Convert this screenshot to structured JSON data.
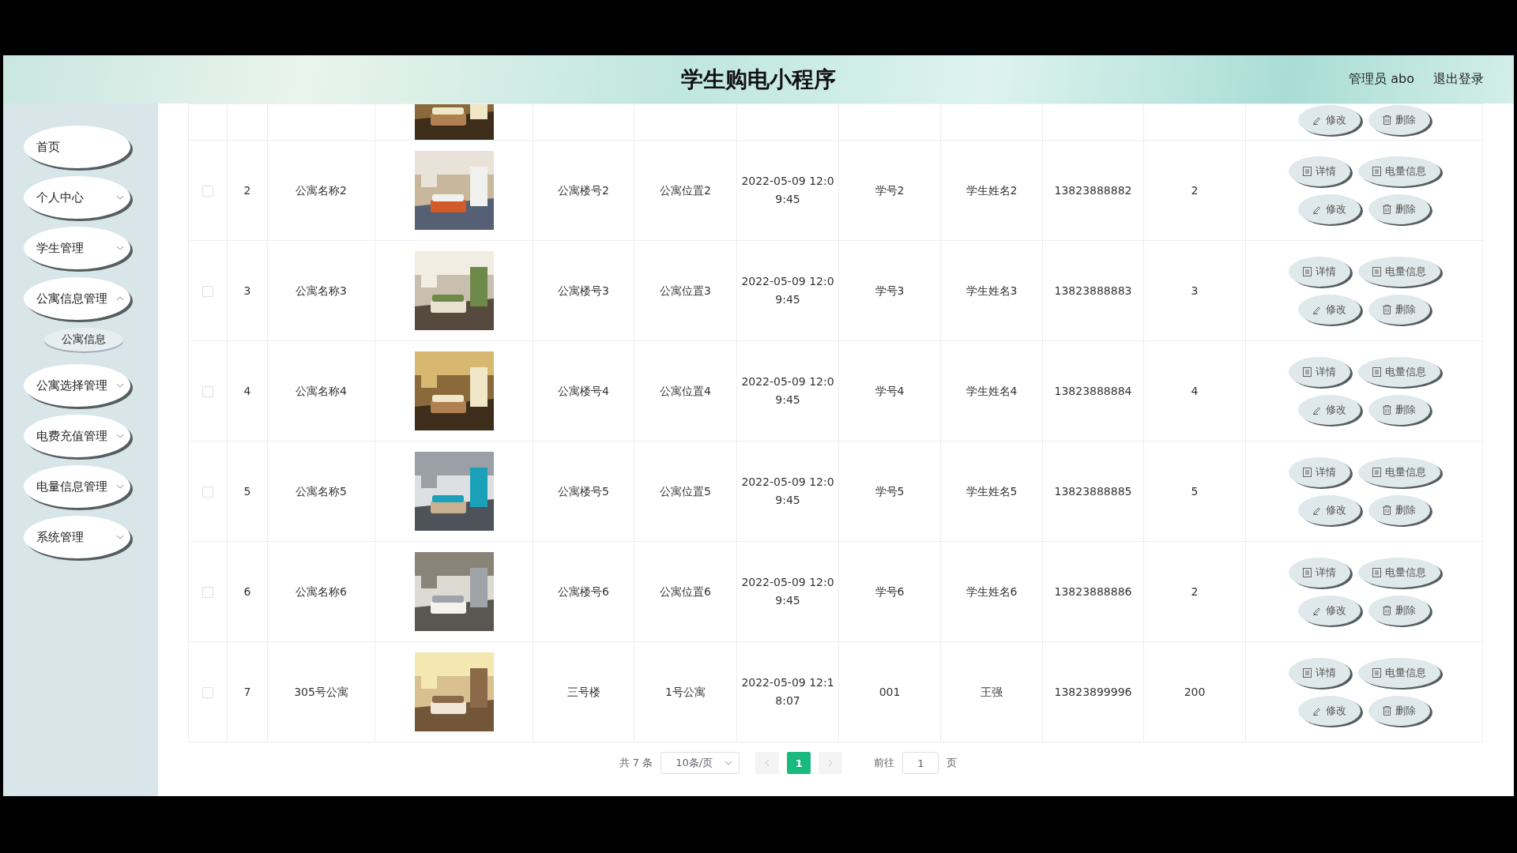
{
  "header": {
    "title": "学生购电小程序",
    "user": "管理员 abo",
    "logout": "退出登录"
  },
  "sidebar": {
    "items": [
      {
        "label": "首页",
        "has_arrow": false
      },
      {
        "label": "个人中心",
        "has_arrow": true,
        "expanded": false
      },
      {
        "label": "学生管理",
        "has_arrow": true,
        "expanded": false
      },
      {
        "label": "公寓信息管理",
        "has_arrow": true,
        "expanded": true,
        "children": [
          {
            "label": "公寓信息"
          }
        ]
      },
      {
        "label": "公寓选择管理",
        "has_arrow": true,
        "expanded": false
      },
      {
        "label": "电费充值管理",
        "has_arrow": true,
        "expanded": false
      },
      {
        "label": "电量信息管理",
        "has_arrow": true,
        "expanded": false
      },
      {
        "label": "系统管理",
        "has_arrow": true,
        "expanded": false
      }
    ]
  },
  "table": {
    "cut_row": {
      "actions": [
        {
          "kind": "edit",
          "label": "修改"
        },
        {
          "kind": "delete",
          "label": "删除"
        }
      ]
    },
    "rows": [
      {
        "checked": false,
        "index": "2",
        "name": "公寓名称2",
        "building": "公寓楼号2",
        "location": "公寓位置2",
        "time": "2022-05-09 12:09:45",
        "student_no": "学号2",
        "student_name": "学生姓名2",
        "phone": "13823888882",
        "column_11": "2",
        "actions": [
          {
            "kind": "detail",
            "label": "详情"
          },
          {
            "kind": "power",
            "label": "电量信息"
          },
          {
            "kind": "edit",
            "label": "修改"
          },
          {
            "kind": "delete",
            "label": "删除"
          }
        ]
      },
      {
        "checked": false,
        "index": "3",
        "name": "公寓名称3",
        "building": "公寓楼号3",
        "location": "公寓位置3",
        "time": "2022-05-09 12:09:45",
        "student_no": "学号3",
        "student_name": "学生姓名3",
        "phone": "13823888883",
        "column_11": "3",
        "actions": [
          {
            "kind": "detail",
            "label": "详情"
          },
          {
            "kind": "power",
            "label": "电量信息"
          },
          {
            "kind": "edit",
            "label": "修改"
          },
          {
            "kind": "delete",
            "label": "删除"
          }
        ]
      },
      {
        "checked": false,
        "index": "4",
        "name": "公寓名称4",
        "building": "公寓楼号4",
        "location": "公寓位置4",
        "time": "2022-05-09 12:09:45",
        "student_no": "学号4",
        "student_name": "学生姓名4",
        "phone": "13823888884",
        "column_11": "4",
        "actions": [
          {
            "kind": "detail",
            "label": "详情"
          },
          {
            "kind": "power",
            "label": "电量信息"
          },
          {
            "kind": "edit",
            "label": "修改"
          },
          {
            "kind": "delete",
            "label": "删除"
          }
        ]
      },
      {
        "checked": false,
        "index": "5",
        "name": "公寓名称5",
        "building": "公寓楼号5",
        "location": "公寓位置5",
        "time": "2022-05-09 12:09:45",
        "student_no": "学号5",
        "student_name": "学生姓名5",
        "phone": "13823888885",
        "column_11": "5",
        "actions": [
          {
            "kind": "detail",
            "label": "详情"
          },
          {
            "kind": "power",
            "label": "电量信息"
          },
          {
            "kind": "edit",
            "label": "修改"
          },
          {
            "kind": "delete",
            "label": "删除"
          }
        ]
      },
      {
        "checked": false,
        "index": "6",
        "name": "公寓名称6",
        "building": "公寓楼号6",
        "location": "公寓位置6",
        "time": "2022-05-09 12:09:45",
        "student_no": "学号6",
        "student_name": "学生姓名6",
        "phone": "13823888886",
        "column_11": "2",
        "actions": [
          {
            "kind": "detail",
            "label": "详情"
          },
          {
            "kind": "power",
            "label": "电量信息"
          },
          {
            "kind": "edit",
            "label": "修改"
          },
          {
            "kind": "delete",
            "label": "删除"
          }
        ]
      },
      {
        "checked": false,
        "index": "7",
        "name": "305号公寓",
        "building": "三号楼",
        "location": "1号公寓",
        "time": "2022-05-09 12:18:07",
        "student_no": "001",
        "student_name": "王强",
        "phone": "13823899996",
        "column_11": "200",
        "actions": [
          {
            "kind": "detail",
            "label": "详情"
          },
          {
            "kind": "power",
            "label": "电量信息"
          },
          {
            "kind": "edit",
            "label": "修改"
          },
          {
            "kind": "delete",
            "label": "删除"
          }
        ]
      }
    ]
  },
  "pagination": {
    "total": "共 7 条",
    "page_size": "10条/页",
    "pages": [
      {
        "label": "1",
        "selected": true
      }
    ],
    "goto_label": "前往",
    "goto_value": "1",
    "goto_suffix": "页"
  }
}
